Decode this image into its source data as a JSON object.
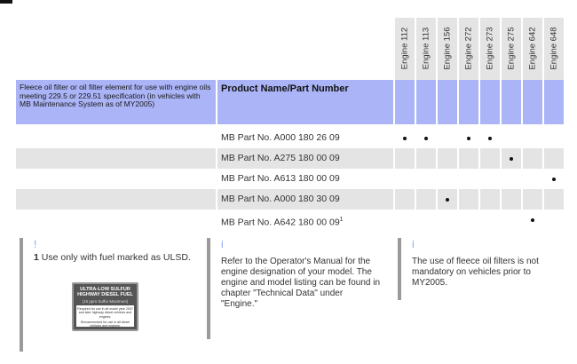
{
  "engines": [
    "Engine 112",
    "Engine 113",
    "Engine 156",
    "Engine 272",
    "Engine 273",
    "Engine 275",
    "Engine 642",
    "Engine 648"
  ],
  "header": {
    "description": "Fleece oil filter or oil filter element for use with engine oils meeting 229.5 or 229.51 specification (in vehicles with MB Maintenance System as of MY2005)",
    "product_col": "Product Name/Part Number"
  },
  "rows": [
    {
      "part": "MB Part No. A000 180 26 09",
      "sup": "",
      "applies": [
        true,
        true,
        false,
        true,
        true,
        false,
        false,
        false
      ]
    },
    {
      "part": "MB Part No. A275 180 00 09",
      "sup": "",
      "applies": [
        false,
        false,
        false,
        false,
        false,
        true,
        false,
        false
      ]
    },
    {
      "part": "MB Part No. A613 180 00 09",
      "sup": "",
      "applies": [
        false,
        false,
        false,
        false,
        false,
        false,
        false,
        true
      ]
    },
    {
      "part": "MB Part No. A000 180 30 09",
      "sup": "",
      "applies": [
        false,
        false,
        true,
        false,
        false,
        false,
        false,
        false
      ]
    },
    {
      "part": "MB Part No. A642 180 00 09",
      "sup": "1",
      "applies": [
        false,
        false,
        false,
        false,
        false,
        false,
        true,
        false
      ]
    }
  ],
  "notes": {
    "footnote": {
      "marker": "!",
      "number": "1",
      "text": "Use only with fuel marked as ULSD."
    },
    "fuel_label": {
      "title": "ULTRA-LOW SULFUR HIGHWAY DIESEL FUEL",
      "subtitle": "(15 ppm Sulfur Maximum)",
      "required": "Required for use in all model year 2007 and later highway diesel vehicles and engines.",
      "recommended": "Recommended for use in all diesel vehicles and engines."
    },
    "info1": {
      "marker": "i",
      "text": "Refer to the Operator's Manual for the engine designation of your model. The engine and model listing can be found in chapter \"Technical Data\" under \"Engine.\""
    },
    "info2": {
      "marker": "i",
      "text": "The use of fleece oil filters is not mandatory on vehicles prior to MY2005."
    }
  }
}
